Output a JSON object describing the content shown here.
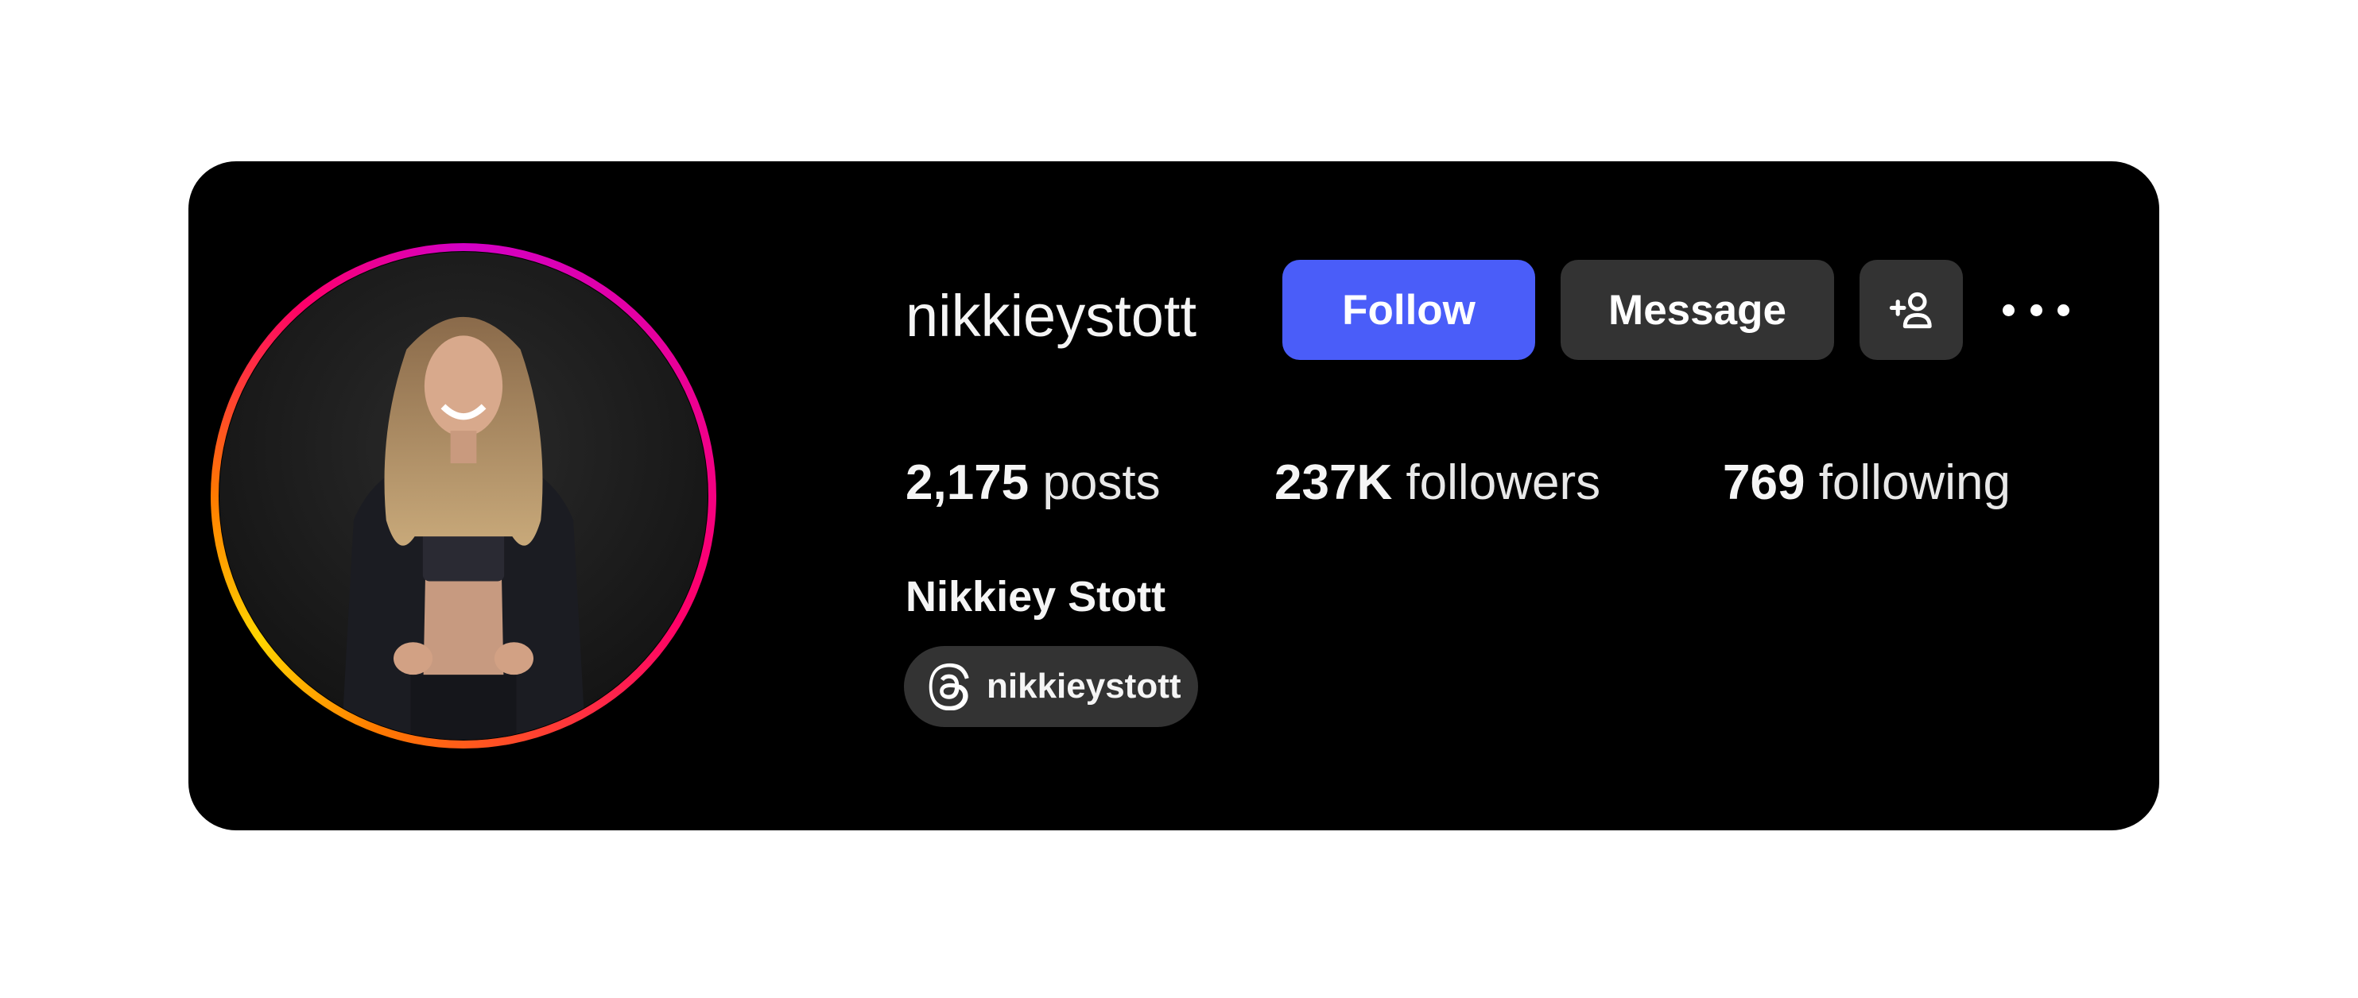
{
  "profile": {
    "username": "nikkieystott",
    "full_name": "Nikkiey Stott",
    "avatar_image": "profile-photo"
  },
  "actions": {
    "follow_label": "Follow",
    "message_label": "Message",
    "add_user_icon": "add-user-icon",
    "more_icon": "more-options-icon"
  },
  "stats": {
    "posts_count": "2,175",
    "posts_label": "posts",
    "followers_count": "237K",
    "followers_label": "followers",
    "following_count": "769",
    "following_label": "following"
  },
  "threads": {
    "icon": "threads-icon",
    "handle": "nikkieystott"
  },
  "colors": {
    "card_background": "#000000",
    "follow_button": "#4a5df9",
    "secondary_button": "#333333",
    "story_ring_gradient": [
      "#d300c5",
      "#ff0069",
      "#ff7a00",
      "#ffd600"
    ]
  }
}
